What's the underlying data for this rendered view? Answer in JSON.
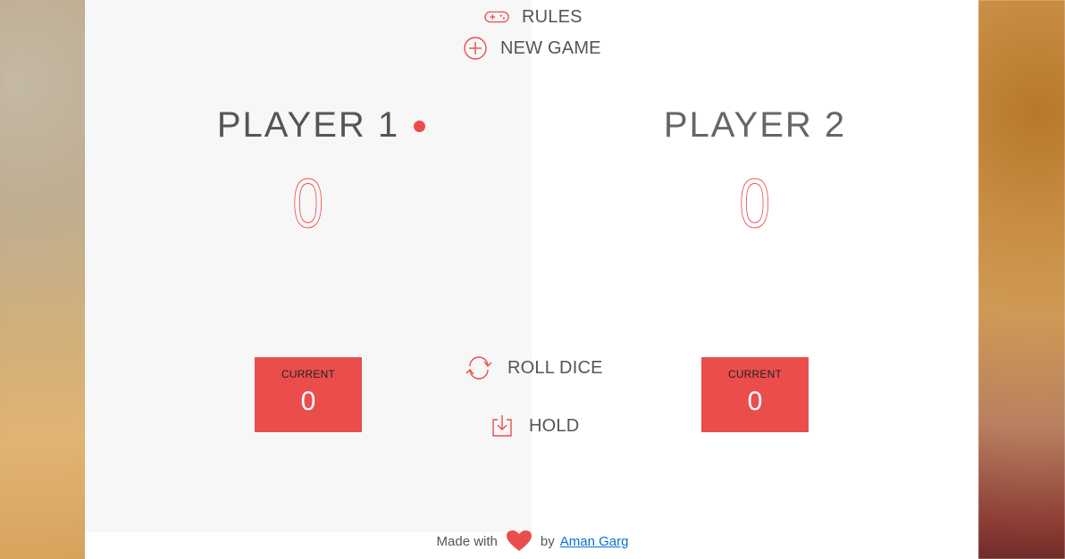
{
  "top": {
    "rules": {
      "label": "RULES",
      "icon": "gamepad-icon"
    },
    "new_game": {
      "label": "NEW GAME",
      "icon": "plus-circle-icon"
    }
  },
  "players": [
    {
      "name": "PLAYER 1",
      "score": "0",
      "current_label": "CURRENT",
      "current_value": "0",
      "active": true
    },
    {
      "name": "PLAYER 2",
      "score": "0",
      "current_label": "CURRENT",
      "current_value": "0",
      "active": false
    }
  ],
  "controls": {
    "roll": {
      "label": "ROLL DICE",
      "icon": "refresh-icon"
    },
    "hold": {
      "label": "HOLD",
      "icon": "download-icon"
    }
  },
  "footer": {
    "made_with": "Made with",
    "by": "by",
    "author": "Aman Garg"
  },
  "colors": {
    "accent": "#EB4D4D",
    "text": "#555555",
    "link": "#0A6FD4",
    "panel_left": "#F7F7F7",
    "panel_right": "#FFFFFF"
  }
}
